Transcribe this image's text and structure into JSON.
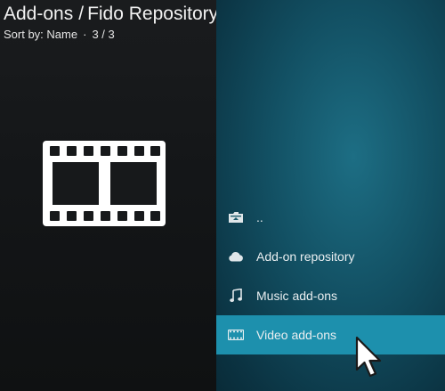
{
  "header": {
    "title": "Add-ons",
    "separator": "/",
    "subtitle_path": "Fido Repository",
    "sort_label": "Sort by: Name",
    "dot": "·",
    "count": "3 / 3"
  },
  "preview": {
    "icon": "film-strip-icon"
  },
  "list": {
    "items": [
      {
        "label": "..",
        "icon": "parent-folder-icon"
      },
      {
        "label": "Add-on repository",
        "icon": "cloud-icon"
      },
      {
        "label": "Music add-ons",
        "icon": "music-note-icon"
      },
      {
        "label": "Video add-ons",
        "icon": "film-icon",
        "focused": true
      }
    ]
  },
  "colors": {
    "focus": "#1d90ad",
    "left_bg": "#141618",
    "right_bg": "#124f62"
  }
}
